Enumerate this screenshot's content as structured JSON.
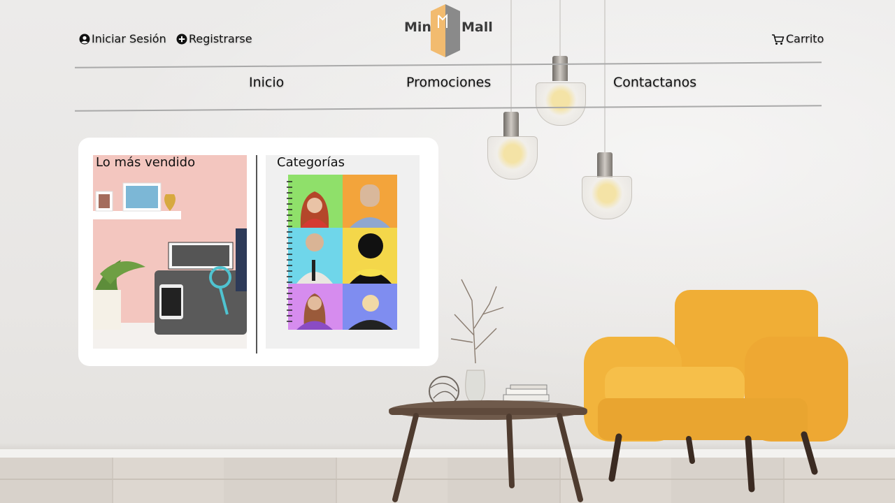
{
  "header": {
    "login_label": "Iniciar Sesión",
    "register_label": "Registrarse",
    "cart_label": "Carrito",
    "logo": {
      "left_word": "Mini",
      "right_word": "Mall"
    }
  },
  "nav": {
    "items": [
      {
        "label": "Inicio"
      },
      {
        "label": "Promociones"
      },
      {
        "label": "Contactanos"
      }
    ]
  },
  "featured": {
    "best_sellers": {
      "title": "Lo más vendido"
    },
    "categories": {
      "title": "Categorías"
    }
  },
  "icons": {
    "login": "user-circle-icon",
    "register": "plus-circle-icon",
    "cart": "cart-icon"
  },
  "colors": {
    "logo_orange": "#f2bb6f",
    "logo_gray": "#8a8a8a",
    "accent_yellow": "#f2b437"
  }
}
